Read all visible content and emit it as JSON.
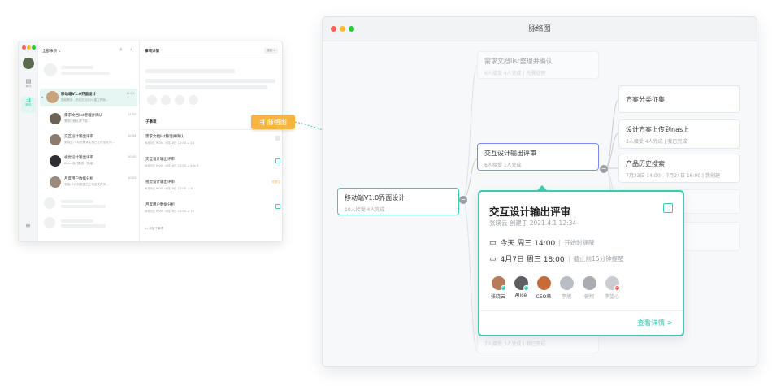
{
  "mini_app": {
    "filter_label": "全部事项 ⌄",
    "rail": {
      "item1": "事项",
      "item2": "脉络"
    },
    "list_items": [
      {
        "title": "移动端V1.0界面设计",
        "sub": "围绕需求...完成交互设计,建立界面...",
        "time": "14:03"
      },
      {
        "title": "需求文档list整理并确认",
        "sub": "需求已确认请下载...",
        "time": "11:30"
      },
      {
        "title": "交互设计输出评审",
        "sub": "张晓云: 5月份需求文档已上传至文件...",
        "time": "10:45"
      },
      {
        "title": "视觉设计输出评审",
        "sub": "Alice:我们要统一风格...",
        "time": "10:20"
      },
      {
        "title": "月度用户数据分析",
        "sub": "张晓: 5月份数据已上传至文件夹...",
        "time": "10:02"
      }
    ],
    "detail": {
      "header": "事项详情",
      "header_btn": "展起 >",
      "subtask_header": "子事项",
      "subtasks": [
        {
          "title": "需求文档list整理并确认",
          "meta": "6月5日 9:00 - 6月20日 12:00   ⊿ 10"
        },
        {
          "title": "交互设计输出评审",
          "meta": "6月5日 9:00 - 6月20日 12:00   ⊿ 4  ⇆ 9"
        },
        {
          "title": "视觉设计输出评审",
          "meta": "6月5日 9:00 - 6月20日 12:00   ⊿ 3",
          "flag": "未提交"
        },
        {
          "title": "月度用户数据分析",
          "meta": "6月5日 9:00 - 6月20日 12:00   ⊿ 10"
        }
      ],
      "add_subtask": "⇆ 添加子事项"
    }
  },
  "callout": {
    "icon": "mindmap-icon",
    "label": "脉络图",
    "color": "#f7b53d"
  },
  "mindmap": {
    "window_title": "脉络图",
    "root": {
      "title": "移动端V1.0界面设计",
      "sub": "10人接受 4人完成"
    },
    "faded_top": {
      "title": "需求文档list整理并确认",
      "sub": "6人接受 4人完成 | 先需处理"
    },
    "middle": {
      "title": "交互设计输出评审",
      "sub": "6人接受 1人完成"
    },
    "faded_bottom": {
      "sub": "7人接受 3人完成 | 我已完成"
    },
    "right_nodes": [
      {
        "title": "方案分类征集",
        "sub": ""
      },
      {
        "title": "设计方案上传到nas上",
        "sub": "3人接受 4人完成 | 我已完成"
      },
      {
        "title": "产品历史搜索",
        "sub": "7月23日 14:00 – 7月24日 16:00 | 我创建"
      }
    ]
  },
  "card": {
    "title": "交互设计输出评审",
    "subtitle": "张晓云 创建于 2021.4.1 12:34",
    "start": {
      "date": "今天 周三 14:00",
      "note": "开始时提醒"
    },
    "end": {
      "date": "4月7日 周三 18:00",
      "note": "截止前15分钟提醒"
    },
    "people": [
      {
        "name": "张晓云",
        "status": "done",
        "color": "#b77a5a",
        "active": true
      },
      {
        "name": "Alice",
        "status": "done",
        "color": "#5d5f63",
        "active": true
      },
      {
        "name": "CEO章",
        "status": "none",
        "color": "#c76b3a",
        "active": true
      },
      {
        "name": "李旭",
        "status": "none",
        "color": "#b9bec4",
        "active": false
      },
      {
        "name": "健翔",
        "status": "none",
        "color": "#a9adb2",
        "active": false
      },
      {
        "name": "李望心",
        "status": "rejected",
        "color": "#c9ccd0",
        "active": false
      }
    ],
    "more_link": "查看详情 >",
    "accent": "#3fc9b1"
  }
}
